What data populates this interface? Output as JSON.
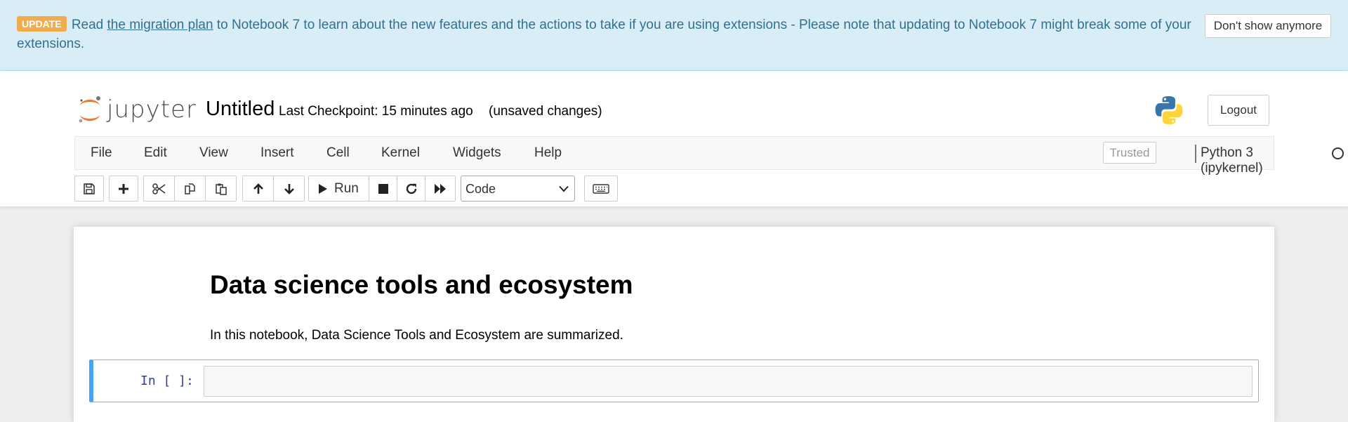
{
  "banner": {
    "badge": "UPDATE",
    "text_before": "Read ",
    "link": "the migration plan",
    "text_after": " to Notebook 7 to learn about the new features and the actions to take if you are using extensions - Please note that updating to Notebook 7 might break some of your extensions.",
    "dismiss_label": "Don't show anymore",
    "bg_color": "#d9edf7",
    "text_color": "#31708f"
  },
  "header": {
    "logo_text": "jupyter",
    "notebook_title": "Untitled",
    "checkpoint": "Last Checkpoint: 15 minutes ago",
    "status": "(unsaved changes)",
    "logout_label": "Logout"
  },
  "menubar": {
    "items": [
      "File",
      "Edit",
      "View",
      "Insert",
      "Cell",
      "Kernel",
      "Widgets",
      "Help"
    ],
    "trusted": "Trusted",
    "kernel": "Python 3 (ipykernel)"
  },
  "toolbar": {
    "run_label": "Run",
    "cell_type": "Code",
    "icons": [
      "save-icon",
      "plus-icon",
      "cut-icon",
      "copy-icon",
      "paste-icon",
      "arrow-up-icon",
      "arrow-down-icon",
      "play-icon",
      "stop-icon",
      "restart-icon",
      "fast-forward-icon",
      "keyboard-icon"
    ]
  },
  "notebook": {
    "heading": "Data science tools and ecosystem",
    "paragraph": "In this notebook, Data Science Tools and Ecosystem are summarized.",
    "cell_prompt": "In [ ]:",
    "cell_border_color": "#42a5f5"
  }
}
